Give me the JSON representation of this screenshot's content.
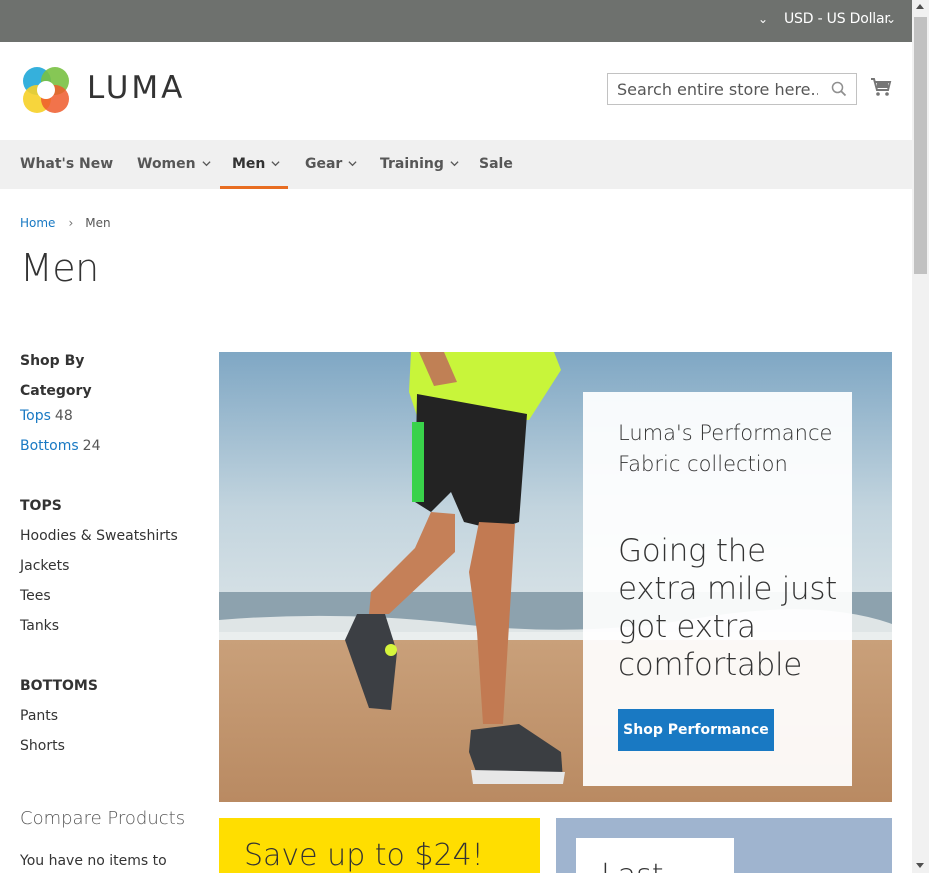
{
  "topbar": {
    "currency_label": "USD - US Dollar"
  },
  "header": {
    "logo_text": "LUMA",
    "search_placeholder": "Search entire store here...",
    "icons": [
      "search-icon",
      "cart-icon"
    ]
  },
  "nav": {
    "items": [
      {
        "label": "What's New",
        "has_caret": false,
        "active": false
      },
      {
        "label": "Women",
        "has_caret": true,
        "active": false
      },
      {
        "label": "Men",
        "has_caret": true,
        "active": true
      },
      {
        "label": "Gear",
        "has_caret": true,
        "active": false
      },
      {
        "label": "Training",
        "has_caret": true,
        "active": false
      },
      {
        "label": "Sale",
        "has_caret": false,
        "active": false
      }
    ]
  },
  "breadcrumbs": {
    "home": "Home",
    "separator": "›",
    "current": "Men"
  },
  "page_title": "Men",
  "sidebar": {
    "shop_by": "Shop By",
    "category_heading": "Category",
    "categories": [
      {
        "label": "Tops",
        "count": "48"
      },
      {
        "label": "Bottoms",
        "count": "24"
      }
    ],
    "tops_heading": "TOPS",
    "tops_items": [
      "Hoodies & Sweatshirts",
      "Jackets",
      "Tees",
      "Tanks"
    ],
    "bottoms_heading": "BOTTOMS",
    "bottoms_items": [
      "Pants",
      "Shorts"
    ],
    "compare_heading": "Compare Products",
    "compare_note": "You have no items to"
  },
  "hero": {
    "subtitle": "Luma's Performance Fabric collection",
    "headline": "Going the extra mile just got extra comfortable",
    "button_label": "Shop Performance"
  },
  "promos": {
    "yellow_text": "Save up to $24!",
    "blue_text": "Last"
  },
  "colors": {
    "topbar": "#6e716e",
    "link_blue": "#1979c3",
    "nav_active": "#e86d22",
    "promo_yellow": "#ffde00"
  }
}
